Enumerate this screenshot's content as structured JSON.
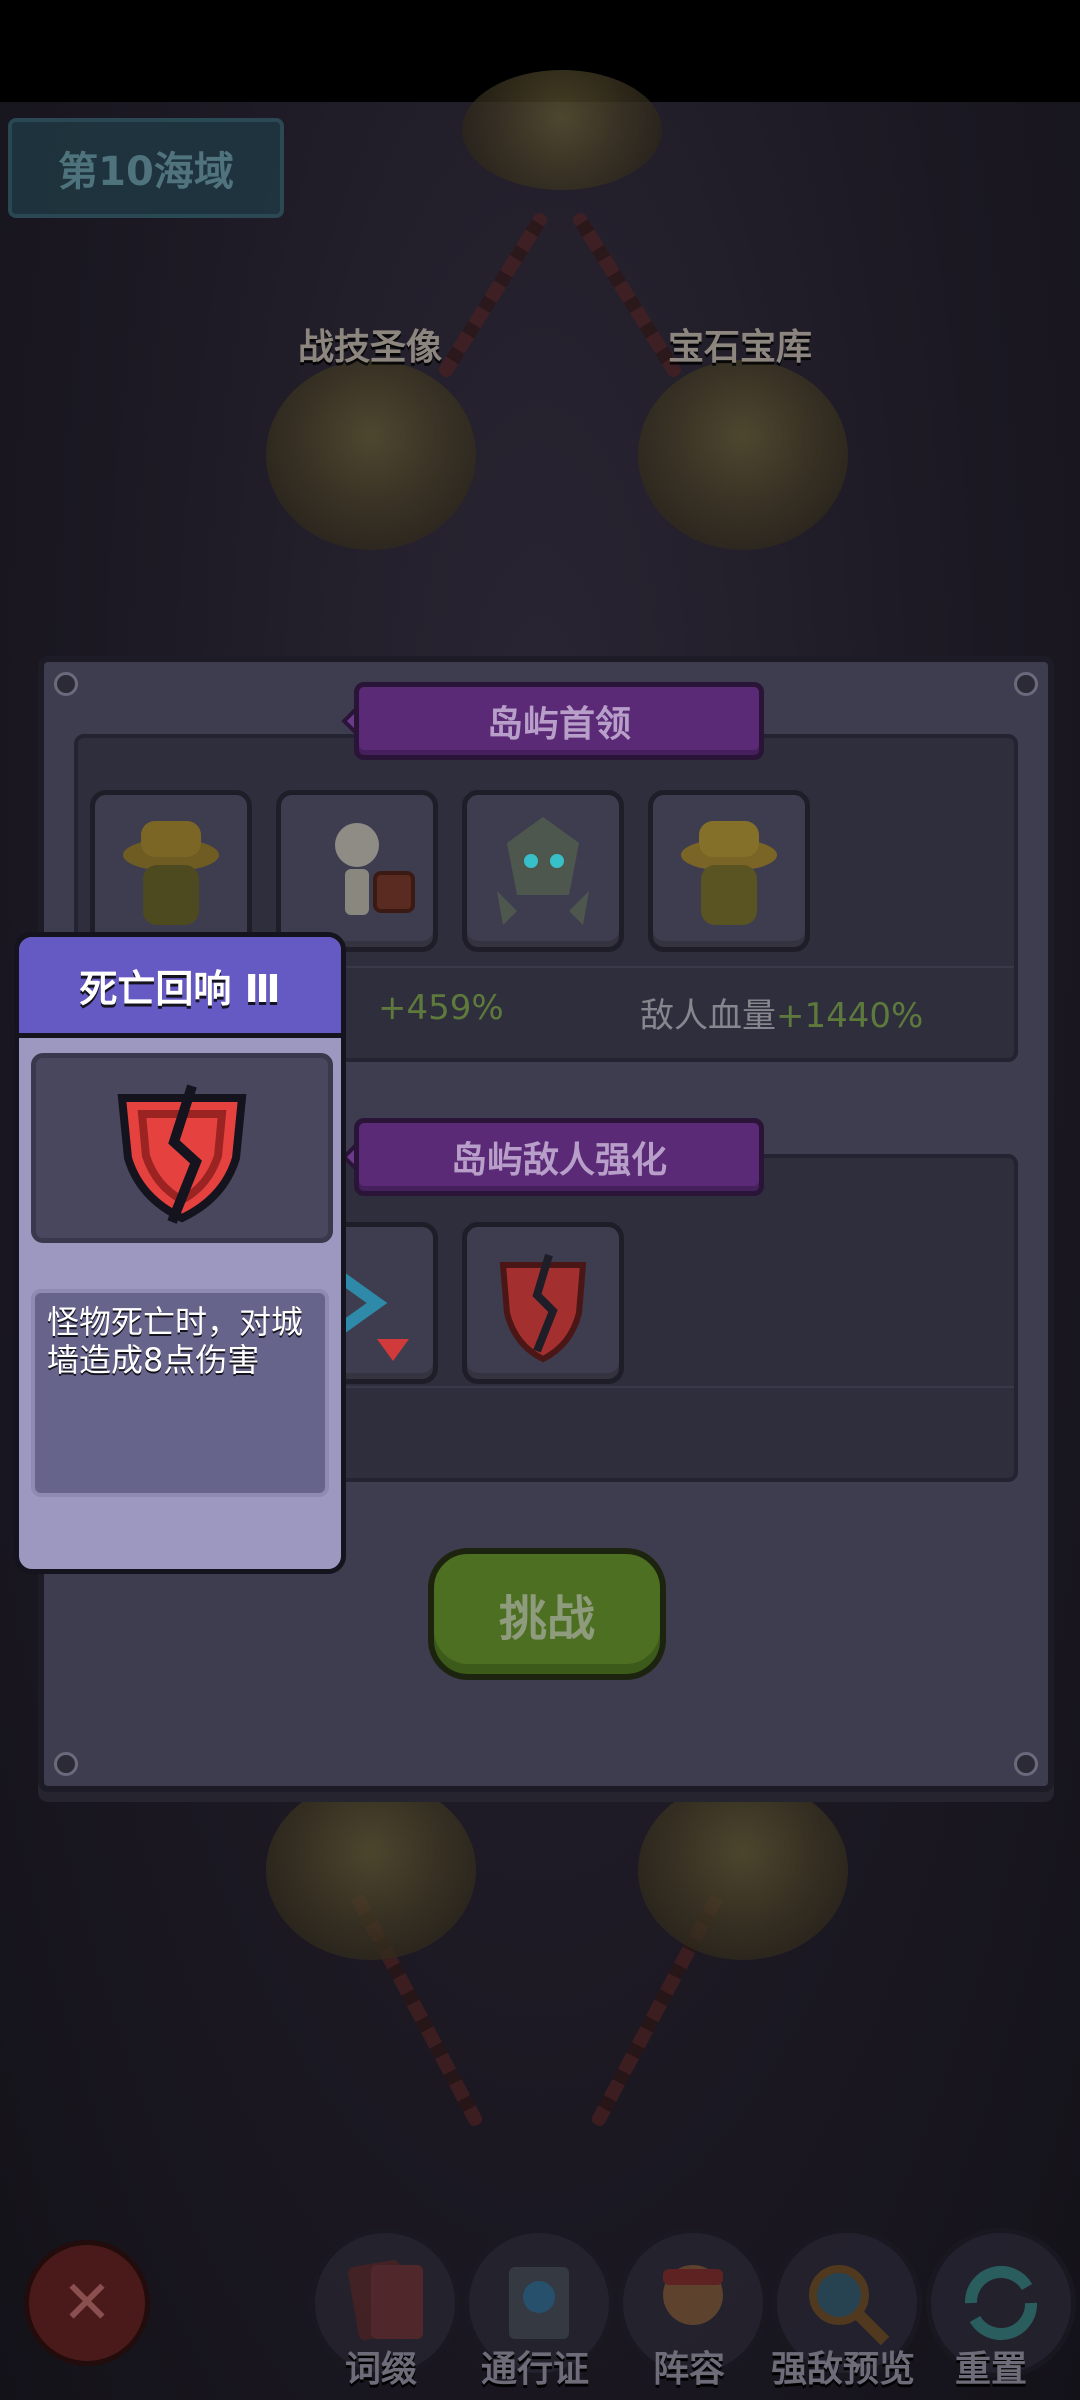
{
  "map": {
    "region_title": "第10海域",
    "islands": [
      {
        "label": "战技圣像"
      },
      {
        "label": "宝石宝库"
      }
    ]
  },
  "dialog": {
    "boss_section": {
      "title": "岛屿首领",
      "bosses": [
        {
          "icon": "hat-monster-icon"
        },
        {
          "icon": "skeleton-icon"
        },
        {
          "icon": "rock-golem-icon"
        },
        {
          "icon": "hat-monster-icon"
        }
      ],
      "stats": [
        {
          "value": "+459%"
        },
        {
          "label": "敌人血量",
          "value": "+1440%"
        }
      ]
    },
    "enemy_section": {
      "title": "岛屿敌人强化",
      "buffs": [
        {
          "icon": "speed-down-icon"
        },
        {
          "icon": "cracked-shield-icon"
        }
      ]
    },
    "challenge_label": "挑战"
  },
  "tooltip": {
    "title": "死亡回响 Ⅲ",
    "icon": "cracked-shield-icon",
    "description": "怪物死亡时，对城墙造成8点伤害"
  },
  "bottom_nav": {
    "close_icon": "close-icon",
    "items": [
      {
        "label": "词缀",
        "icon": "cards-icon"
      },
      {
        "label": "通行证",
        "icon": "pass-icon"
      },
      {
        "label": "阵容",
        "icon": "hero-icon"
      },
      {
        "label": "强敌预览",
        "icon": "magnifier-icon"
      },
      {
        "label": "重置",
        "icon": "refresh-icon"
      }
    ]
  },
  "colors": {
    "accent_purple": "#6559c4",
    "challenge_green": "#4d6f22",
    "stat_green": "#5d7a3c",
    "shield_red": "#e5413f"
  }
}
